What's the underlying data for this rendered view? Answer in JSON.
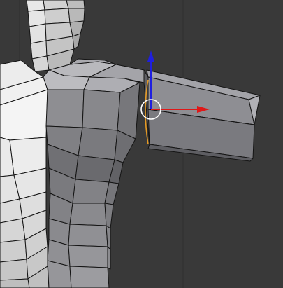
{
  "viewport": {
    "background": "#393939",
    "grid_line_color": "#2f2f2f",
    "mode": "edit-mode"
  },
  "mesh": {
    "object": "human-torso-with-extruded-arm",
    "wire_color": "#141414",
    "light_face": "#d9d9d9",
    "mid_face": "#a6a6a6",
    "dark_face": "#7f7f7f",
    "selected_face": "#8e8e93"
  },
  "gizmo": {
    "x_axis_color": "#e01818",
    "z_axis_color": "#1f1fe0",
    "y_axis_color": "#e59a24",
    "pivot_ring_color": "#ffffff",
    "cursor_icon": "manipulator-pivot-icon"
  }
}
